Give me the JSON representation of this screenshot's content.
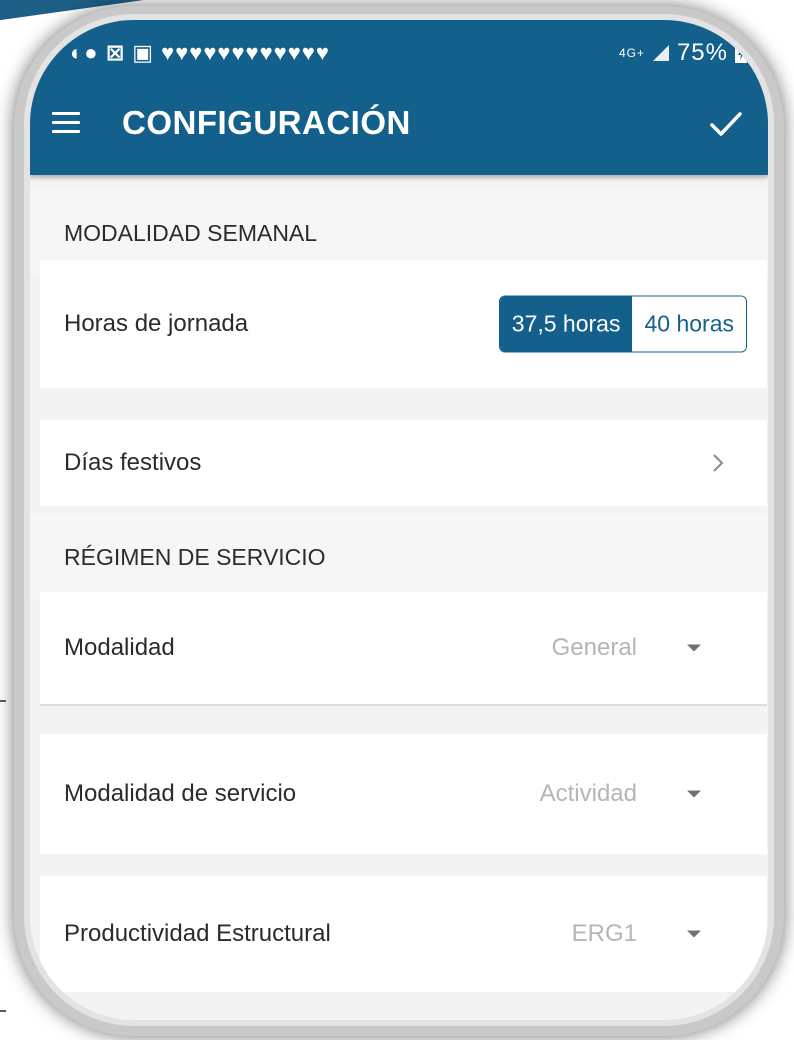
{
  "status_bar": {
    "icons_text": "◐● ⊠ ▣ ♥♥♥♥♥♥♥♥♥♥♥♥",
    "network": "4G+",
    "battery": "75%"
  },
  "app_bar": {
    "title": "CONFIGURACIÓN",
    "menu_icon": "hamburger-menu-icon",
    "confirm_icon": "check-icon",
    "color": "#14608c"
  },
  "sections": {
    "weekly": {
      "header": "MODALIDAD SEMANAL",
      "hours_label": "Horas de jornada",
      "hours_options": [
        "37,5 horas",
        "40 horas"
      ],
      "hours_selected": "37,5 horas"
    },
    "holidays": {
      "label": "Días festivos"
    },
    "service": {
      "header": "RÉGIMEN DE SERVICIO",
      "modality_label": "Modalidad",
      "modality_value": "General",
      "service_mode_label": "Modalidad de servicio",
      "service_mode_value": "Actividad",
      "productivity_label": "Productividad Estructural",
      "productivity_value": "ERG1"
    }
  }
}
